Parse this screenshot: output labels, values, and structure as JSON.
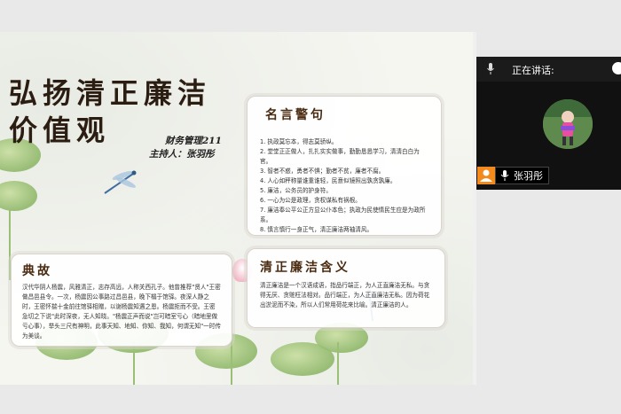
{
  "slide": {
    "title_line1": "弘扬清正廉洁",
    "title_line2": "价值观",
    "class_name": "财务管理211",
    "host": "主持人：张羽彤",
    "quotes": {
      "heading": "名言警句",
      "items": [
        "1. 执政莫忘本，得志莫骄纵。",
        "2. 堂堂正正做人，扎扎实实做事，勤勤恳恳学习，清清白白为官。",
        "3. 智者不惑，勇者不惧；勤者不贫，廉者不腐。",
        "4. 人心如秤称量谁重谁轻，民意似镜照出孰贪孰廉。",
        "5. 廉洁，公务员的护身符。",
        "6. 一心为公是政理，贪权谋私有祸根。",
        "7. 廉洁奉公平公正方显公仆本色；执政为民使情民生应是为政所系。",
        "8. 慎言慎行一身正气，清正廉洁两袖清风。"
      ]
    },
    "story": {
      "heading": "典故",
      "text": "汉代华阴人杨震，风雅清正，志存高远，人称关西孔子。他曾推荐\"贤人\"王密做昌邑县令。一次，杨震因公事路过昌邑县，晚下榻于馆驿。夜深人静之时，王密怀揣十金前往馆驿相赠，以谢杨震知遇之恩。杨震拒而不受。王密急切之下说\"此时深夜，无人知晓。\"杨震正声而说\"岂可暗室亏心（暗地里做亏心事），举头三尺有神明，此事天知、地知、你知、我知，何谓无知\"一时传为美谈。"
    },
    "meaning": {
      "heading": "清正廉洁含义",
      "text": "清正廉洁是一个汉语成语，指品行端正，为人正直廉洁无私。与贪得无厌、贪赃枉法相对。品行端正，为人正直廉洁无私。因为荷花出淤泥而不染，所以人们常用荷花来比喻。清正廉洁的人。"
    }
  },
  "meeting": {
    "speaking_label": "正在讲话:",
    "participant_name": "张羽彤"
  },
  "colors": {
    "title_brown": "#2b1d12",
    "heading_brown": "#4a2a10",
    "person_orange": "#f28a1e",
    "panel_dark": "#111111"
  },
  "icons": [
    "mic-icon",
    "person-icon",
    "dragonfly-icon",
    "arrow-icon"
  ]
}
